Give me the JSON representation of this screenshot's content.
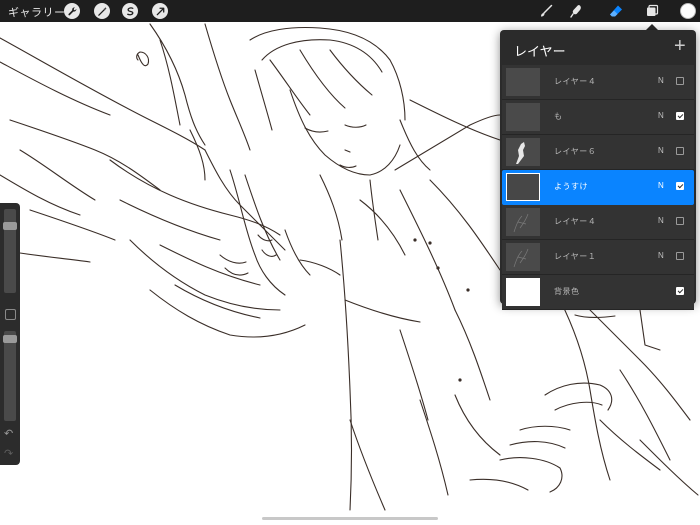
{
  "topbar": {
    "gallery_label": "ギャラリー",
    "left_tools": [
      "wrench-icon",
      "magic-wand-icon",
      "selection-icon",
      "transform-icon"
    ],
    "right_tools": [
      "brush-icon",
      "smudge-icon",
      "eraser-icon",
      "layers-icon"
    ],
    "active_tool": "eraser-icon",
    "current_color": "#ffffff"
  },
  "layers_panel": {
    "title": "レイヤー",
    "add_label": "+",
    "layers": [
      {
        "name": "レイヤー４",
        "blend": "N",
        "visible": false,
        "selected": false,
        "thumb": "empty"
      },
      {
        "name": "も",
        "blend": "N",
        "visible": true,
        "selected": false,
        "thumb": "empty"
      },
      {
        "name": "レイヤー６",
        "blend": "N",
        "visible": false,
        "selected": false,
        "thumb": "figure"
      },
      {
        "name": "ようすけ",
        "blend": "N",
        "visible": true,
        "selected": true,
        "thumb": "empty"
      },
      {
        "name": "レイヤー４",
        "blend": "N",
        "visible": false,
        "selected": false,
        "thumb": "sketch"
      },
      {
        "name": "レイヤー１",
        "blend": "N",
        "visible": false,
        "selected": false,
        "thumb": "sketch"
      },
      {
        "name": "背景色",
        "blend": "",
        "visible": true,
        "selected": false,
        "thumb": "white"
      }
    ]
  },
  "sidebar": {
    "brush_size_fraction": 0.83,
    "opacity_fraction": 0.95,
    "undo_icon": "undo-icon",
    "redo_icon": "redo-icon"
  },
  "colors": {
    "accent": "#0a84ff",
    "topbar": "#1e1e1e",
    "panel": "#2b2b2b"
  }
}
